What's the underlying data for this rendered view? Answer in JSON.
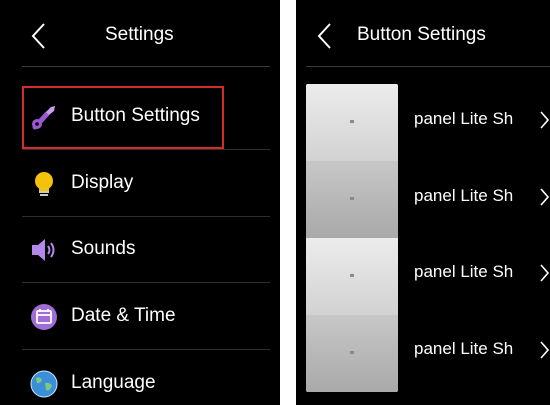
{
  "settings_screen": {
    "title": "Settings",
    "items": [
      {
        "label": "Button Settings",
        "icon": "wrench-icon"
      },
      {
        "label": "Display",
        "icon": "lightbulb-icon"
      },
      {
        "label": "Sounds",
        "icon": "speaker-icon"
      },
      {
        "label": "Date & Time",
        "icon": "calendar-icon"
      },
      {
        "label": "Language",
        "icon": "globe-icon"
      }
    ],
    "selected_index": 0,
    "highlight_color": "#d62b2b"
  },
  "button_settings_screen": {
    "title": "Button Settings",
    "panels": [
      {
        "label": "panel Lite Sh",
        "icon": "chevron-right-icon"
      },
      {
        "label": "panel Lite Sh",
        "icon": "chevron-right-icon"
      },
      {
        "label": "panel Lite Sh",
        "icon": "chevron-right-icon"
      },
      {
        "label": "panel Lite Sh",
        "icon": "chevron-right-icon"
      }
    ]
  },
  "colors": {
    "background": "#000000",
    "text": "#ffffff",
    "wrench_icon": "#9b59d0",
    "bulb_icon": "#f4c20d",
    "speaker_icon": "#b388eb",
    "calendar_icon": "#a06cd5",
    "globe_icon": "#3b8fd8"
  }
}
